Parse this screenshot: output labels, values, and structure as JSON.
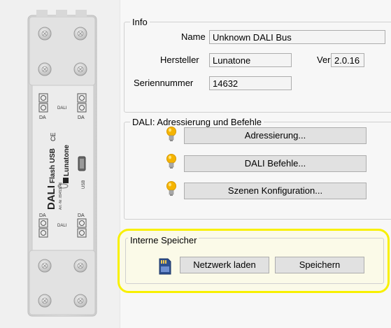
{
  "device": {
    "brand": "Lunatone",
    "model": "DALI",
    "product": "Flash USB",
    "art_no": "Art.-Nr. 89453246",
    "ce_mark": "CE",
    "terminal_label": "DA",
    "dali_label": "DALI",
    "usb_label": "USB"
  },
  "info": {
    "title": "Info",
    "name_label": "Name",
    "name_value": "Unknown DALI Bus",
    "manufacturer_label": "Hersteller",
    "manufacturer_value": "Lunatone",
    "version_label": "Ver",
    "version_value": "2.0.16",
    "serial_label": "Seriennummer",
    "serial_value": "14632"
  },
  "dali": {
    "title": "DALI: Adressierung und Befehle",
    "buttons": [
      {
        "label": "Adressierung...",
        "icon": "lightbulb-icon"
      },
      {
        "label": "DALI Befehle...",
        "icon": "lightbulb-icon"
      },
      {
        "label": "Szenen Konfiguration...",
        "icon": "lightbulb-icon"
      }
    ]
  },
  "storage": {
    "title": "Interne Speicher",
    "icon": "sd-card-icon",
    "load_label": "Netzwerk laden",
    "save_label": "Speichern"
  },
  "colors": {
    "highlight": "#f8f000",
    "bulb": "#f5b400"
  }
}
